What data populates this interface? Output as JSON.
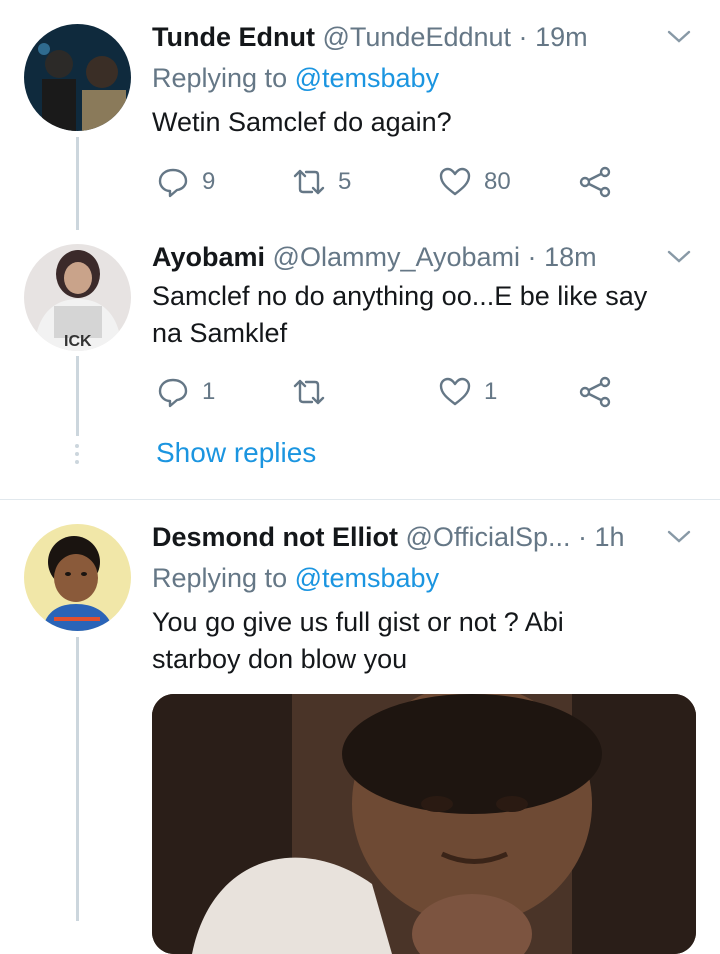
{
  "tweets": [
    {
      "name": "Tunde Ednut",
      "handle": "@TundeEddnut",
      "time": "19m",
      "replying_label": "Replying to",
      "replying_to": "@temsbaby",
      "text": "Wetin Samclef do again?",
      "replies": "9",
      "retweets": "5",
      "likes": "80"
    },
    {
      "name": "Ayobami",
      "handle": "@Olammy_Ayobami",
      "time": "18m",
      "text_line1": "Samclef no do anything oo...E be like say",
      "text_line2": "na Samklef⁡",
      "replies": "1",
      "retweets": "",
      "likes": "1",
      "show_replies": "Show replies"
    },
    {
      "name": "Desmond not Elliot",
      "handle": "@OfficialSp...",
      "time": "1h",
      "replying_label": "Replying to",
      "replying_to": "@temsbaby",
      "text_line1": "You go give us full gist or not ? Abi",
      "text_line2": "starboy don blow you"
    }
  ],
  "separator": "·",
  "icons": [
    "reply-icon",
    "retweet-icon",
    "like-icon",
    "share-icon",
    "chevron-down-icon"
  ],
  "colors": {
    "link": "#1b95e0",
    "muted": "#657786",
    "text": "#14171a",
    "line": "#ccd6dd"
  }
}
